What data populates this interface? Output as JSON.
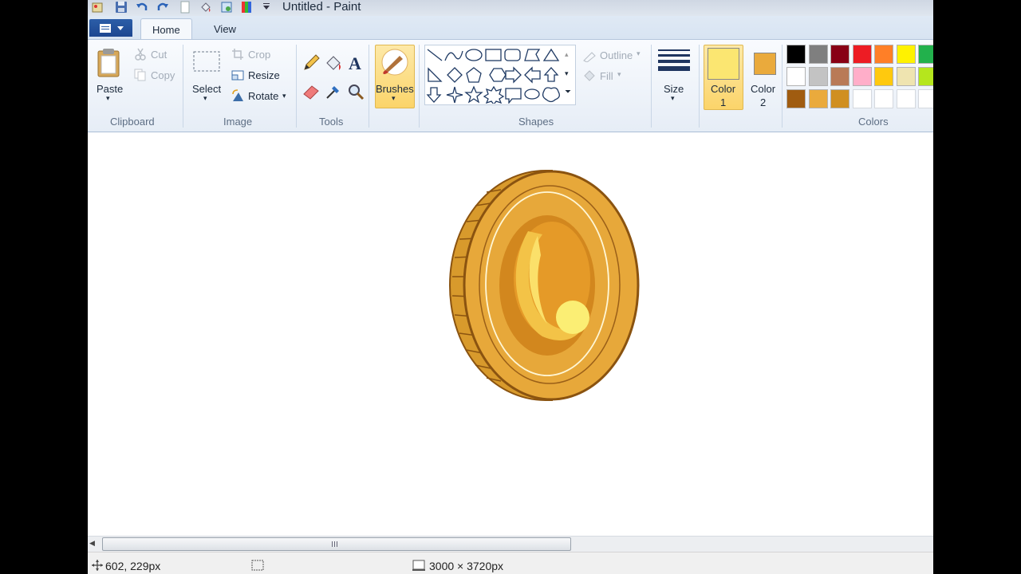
{
  "window": {
    "title": "Untitled - Paint"
  },
  "tabs": {
    "home": "Home",
    "view": "View"
  },
  "clipboard": {
    "paste": "Paste",
    "cut": "Cut",
    "copy": "Copy",
    "group": "Clipboard"
  },
  "image": {
    "select": "Select",
    "crop": "Crop",
    "resize": "Resize",
    "rotate": "Rotate",
    "group": "Image"
  },
  "tools": {
    "group": "Tools"
  },
  "brushes": {
    "label": "Brushes"
  },
  "shapes": {
    "outline": "Outline",
    "fill": "Fill",
    "group": "Shapes"
  },
  "size": {
    "label": "Size"
  },
  "color1": {
    "label_top": "Color",
    "label_bottom": "1",
    "value": "#fbe671"
  },
  "color2": {
    "label_top": "Color",
    "label_bottom": "2",
    "value": "#eaaa3c"
  },
  "colors": {
    "group": "Colors",
    "palette": [
      [
        "#000000",
        "#7f7f7f",
        "#880015",
        "#ed1c24",
        "#ff7f27",
        "#fff200",
        "#22b14c"
      ],
      [
        "#ffffff",
        "#c3c3c3",
        "#b97a57",
        "#ffaec9",
        "#ffc90e",
        "#efe4b0",
        "#b5e61d"
      ],
      [
        "#a05c10",
        "#eaaa3c",
        "#d08f21",
        "#ffffff",
        "#ffffff",
        "#ffffff",
        "#ffffff"
      ]
    ]
  },
  "status": {
    "cursor_pos": "602, 229px",
    "canvas_size": "3000 × 3720px"
  }
}
